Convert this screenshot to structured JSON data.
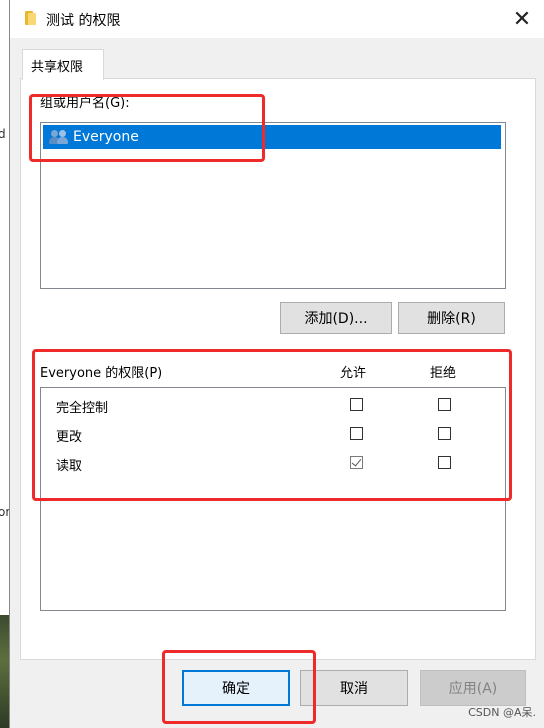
{
  "window": {
    "title": "测试 的权限",
    "close_glyph": "✕"
  },
  "tabs": [
    {
      "label": "共享权限",
      "selected": true
    }
  ],
  "group": {
    "label": "组或用户名(G):",
    "items": [
      {
        "name": "Everyone",
        "icon": "users-icon",
        "selected": true
      }
    ]
  },
  "buttons": {
    "add": "添加(D)...",
    "remove": "删除(R)",
    "ok": "确定",
    "cancel": "取消",
    "apply": "应用(A)"
  },
  "permissions": {
    "header": "Everyone 的权限(P)",
    "allow_header": "允许",
    "deny_header": "拒绝",
    "rows": [
      {
        "name": "完全控制",
        "allow": false,
        "deny": false
      },
      {
        "name": "更改",
        "allow": false,
        "deny": false
      },
      {
        "name": "读取",
        "allow": true,
        "deny": false
      }
    ]
  },
  "background": {
    "edge_fragments": [
      "d",
      "or"
    ],
    "watermark": "CSDN @A呆."
  },
  "colors": {
    "selection": "#0078d7",
    "annotation": "#ee2a2a"
  }
}
